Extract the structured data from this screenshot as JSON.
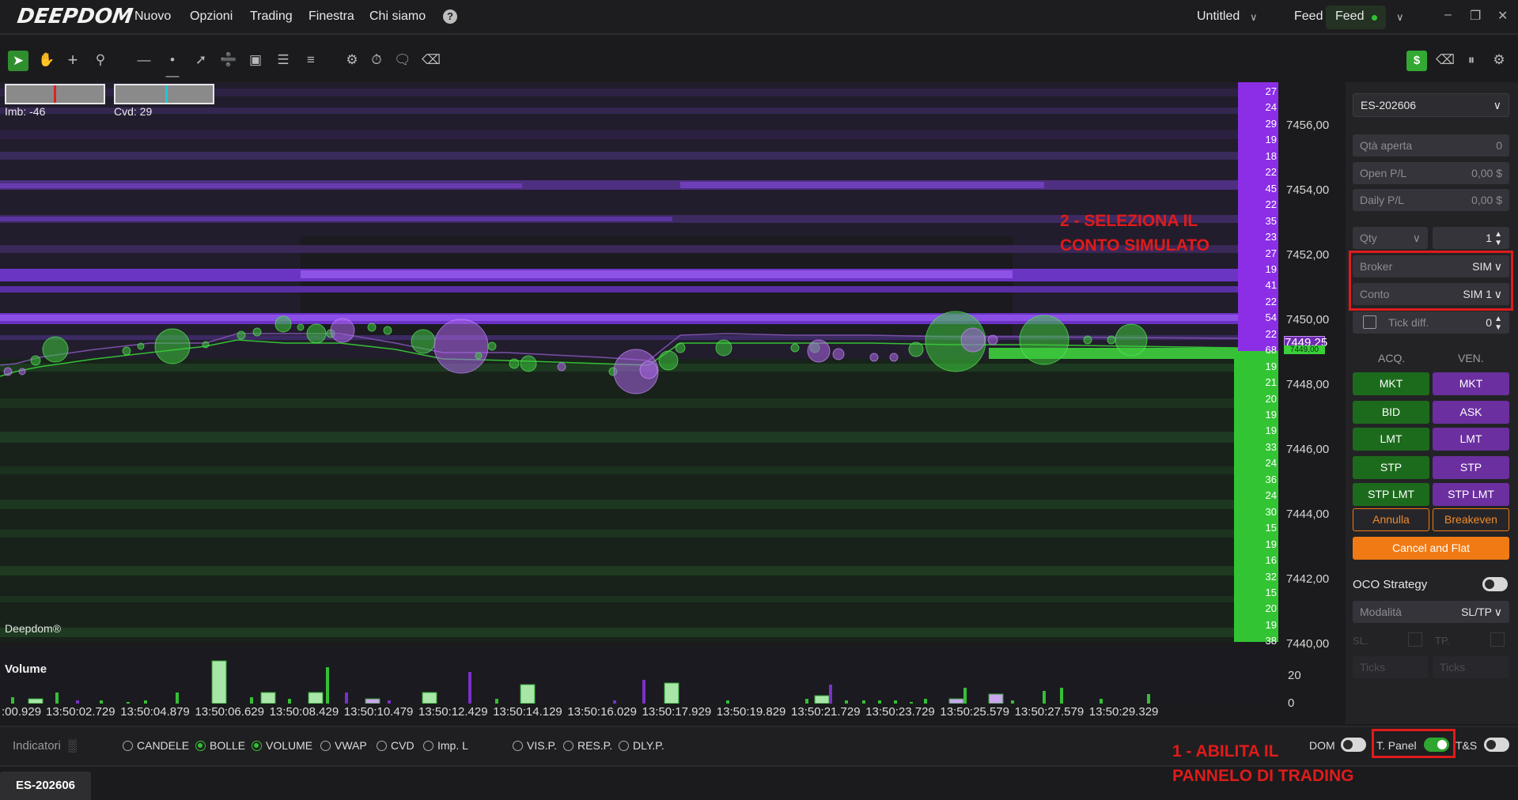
{
  "app": {
    "logo": "DEEPDOM",
    "menu": [
      "Nuovo",
      "Opzioni",
      "Trading",
      "Finestra",
      "Chi siamo"
    ],
    "help_icon": "?",
    "workspace": "Untitled",
    "feed_label": "Feed",
    "feed_status": "Feed",
    "window_controls": [
      "–",
      "❐",
      "✕"
    ]
  },
  "toolbar": {
    "tools": [
      "pointer-icon",
      "hand-icon",
      "crosshair-icon",
      "zoom-icon",
      "hline-icon",
      "ray-icon",
      "trendline-icon",
      "measure-icon",
      "rectangle-icon",
      "lines-icon",
      "fib-icon",
      "settings-sliders-icon",
      "timer-icon",
      "comment-icon",
      "eraser-icon"
    ],
    "right_tools": [
      "dollar-icon",
      "eraser-icon",
      "pause-icon",
      "gear-icon"
    ]
  },
  "indicators": {
    "imbalance": "Imb: -46",
    "cvd": "Cvd: 29",
    "watermark": "Deepdom®"
  },
  "price_axis": [
    "7456,00",
    "7454,00",
    "7452,00",
    "7450,00",
    "7448,00",
    "7446,00",
    "7444,00",
    "7442,00",
    "7440,00"
  ],
  "current_price": "7449,25",
  "current_price_small": "7449,00",
  "dom_values": [
    "27",
    "24",
    "29",
    "19",
    "18",
    "22",
    "45",
    "22",
    "35",
    "23",
    "27",
    "19",
    "41",
    "22",
    "54",
    "22",
    "68",
    "19",
    "21",
    "20",
    "19",
    "19",
    "33",
    "24",
    "36",
    "24",
    "30",
    "15",
    "19",
    "16",
    "32",
    "15",
    "20",
    "19",
    "38"
  ],
  "volume": {
    "title": "Volume",
    "axis": [
      "20",
      "0"
    ]
  },
  "time_axis": [
    ":00.929",
    "13:50:02.729",
    "13:50:04.879",
    "13:50:06.629",
    "13:50:08.429",
    "13:50:10.479",
    "13:50:12.429",
    "13:50:14.129",
    "13:50:16.029",
    "13:50:17.929",
    "13:50:19.829",
    "13:50:21.729",
    "13:50:23.729",
    "13:50:25.579",
    "13:50:27.579",
    "13:50:29.329"
  ],
  "bottom": {
    "indicators_label": "Indicatori",
    "options": [
      {
        "label": "CANDELE",
        "on": false
      },
      {
        "label": "BOLLE",
        "on": true
      },
      {
        "label": "VOLUME",
        "on": true
      },
      {
        "label": "VWAP",
        "on": false
      },
      {
        "label": "CVD",
        "on": false
      },
      {
        "label": "Imp. L",
        "on": false
      }
    ],
    "profiles": [
      "VIS.P.",
      "RES.P.",
      "DLY.P."
    ],
    "dom_label": "DOM",
    "tpanel_label": "T. Panel",
    "ts_label": "T&S",
    "tab": "ES-202606"
  },
  "panel": {
    "symbol": "ES-202606",
    "qta_aperta": {
      "k": "Qtà aperta",
      "v": "0"
    },
    "open_pl": {
      "k": "Open P/L",
      "v": "0,00 $"
    },
    "daily_pl": {
      "k": "Daily P/L",
      "v": "0,00 $"
    },
    "qty_label": "Qty",
    "qty_value": "1",
    "broker": {
      "k": "Broker",
      "v": "SIM"
    },
    "conto": {
      "k": "Conto",
      "v": "SIM 1"
    },
    "tick_diff": {
      "k": "Tick diff.",
      "v": "0"
    },
    "acq": "ACQ.",
    "ven": "VEN.",
    "buy_buttons": [
      "MKT",
      "BID",
      "LMT",
      "STP",
      "STP LMT"
    ],
    "sell_buttons": [
      "MKT",
      "ASK",
      "LMT",
      "STP",
      "STP LMT"
    ],
    "annulla": "Annulla",
    "breakeven": "Breakeven",
    "cancel_flat": "Cancel and Flat",
    "oco": "OCO Strategy",
    "modalita": {
      "k": "Modalità",
      "v": "SL/TP"
    },
    "sl": "SL.",
    "tp": "TP.",
    "ticks": "Ticks"
  },
  "annotations": {
    "step2_line1": "2 - SELEZIONA IL",
    "step2_line2": "CONTO SIMULATO",
    "step1_line1": "1 - ABILITA IL",
    "step1_line2": "PANNELO DI TRADING"
  },
  "colors": {
    "buy": "#1c6b1c",
    "sell": "#6b2fa0",
    "accent": "#35c035",
    "orange": "#f07a14",
    "annotation": "#e01b1b"
  }
}
